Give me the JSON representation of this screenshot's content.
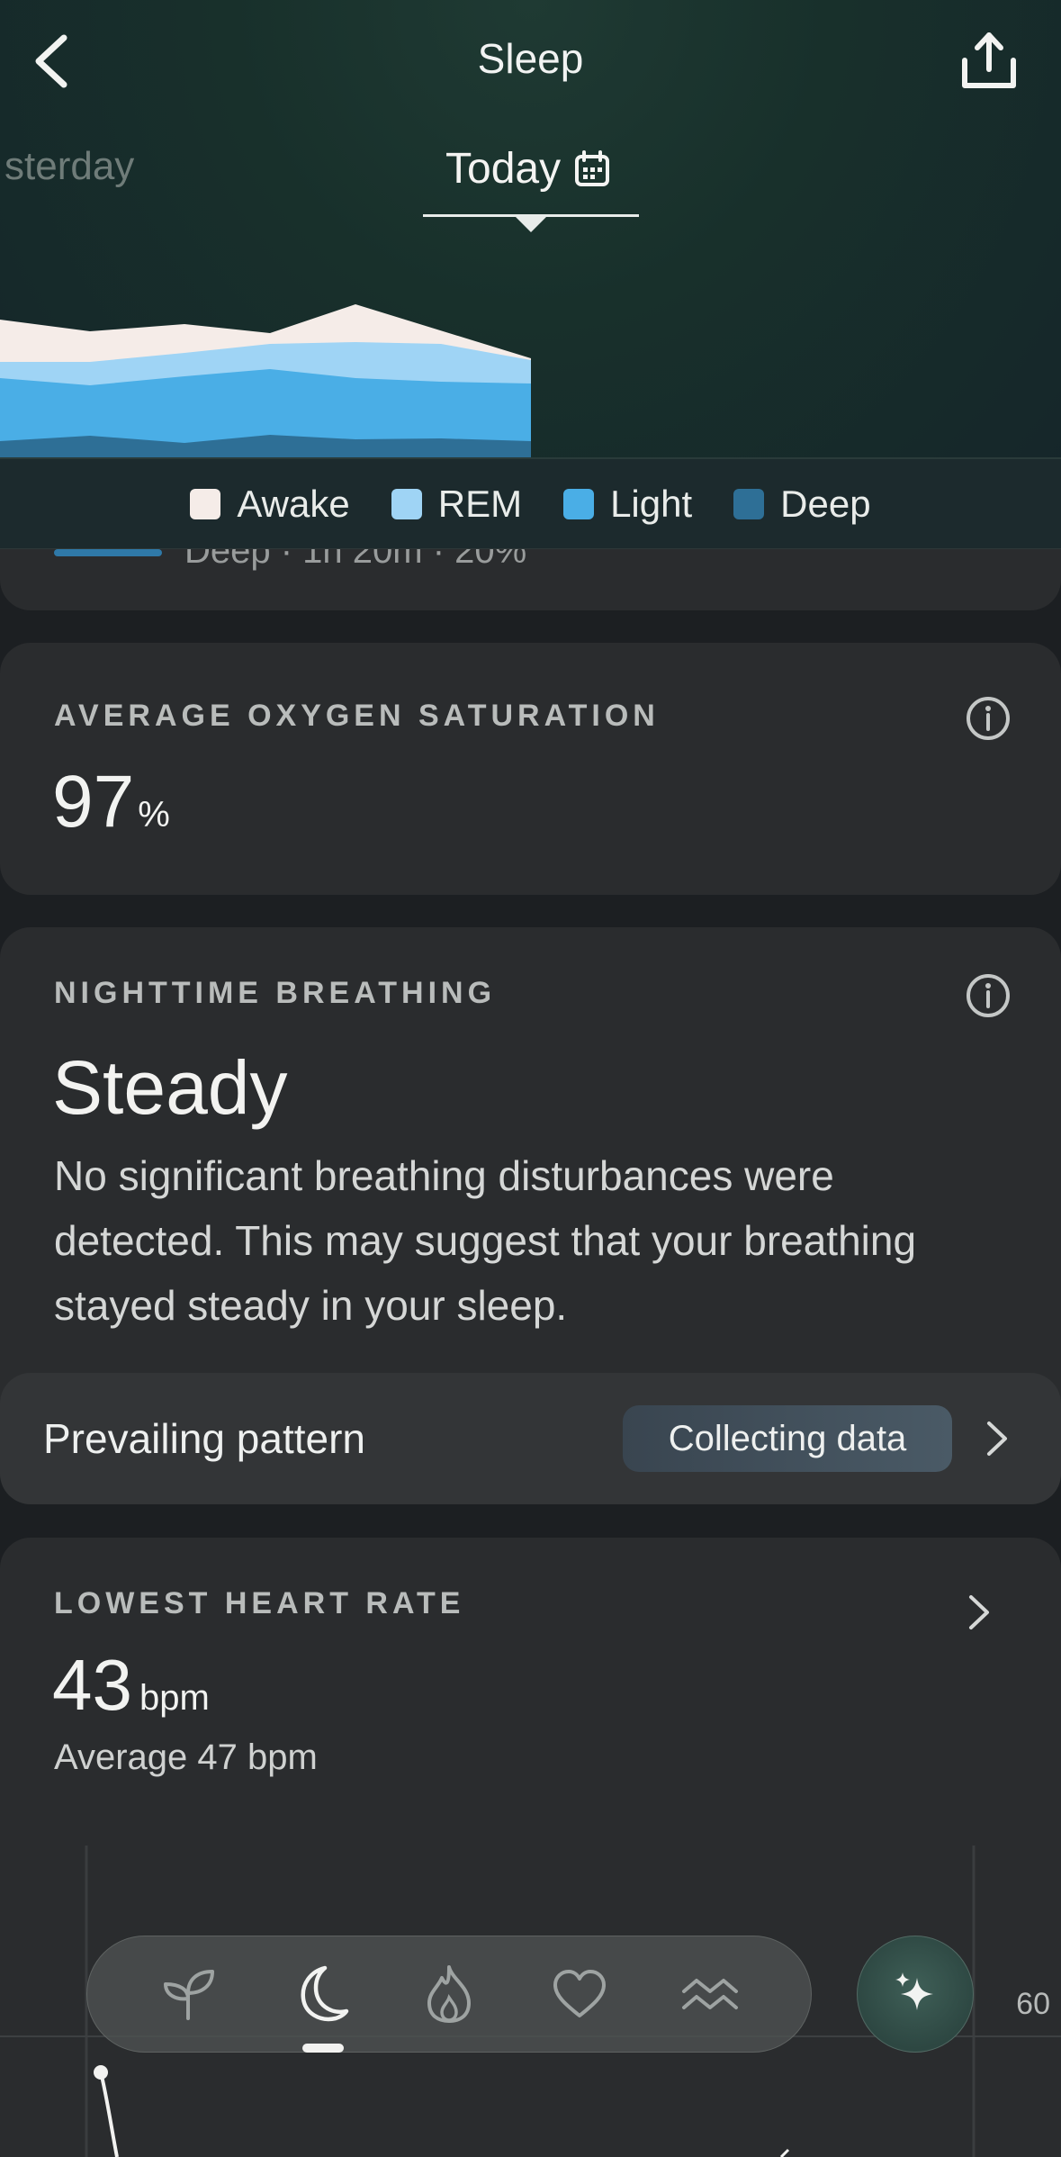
{
  "header": {
    "title": "Sleep",
    "back_icon": "chevron-left-icon",
    "share_icon": "share-icon"
  },
  "day_selector": {
    "previous_label": "sterday",
    "current_label": "Today",
    "calendar_icon": "calendar-icon"
  },
  "legend": [
    {
      "label": "Awake",
      "color": "#f5ece8"
    },
    {
      "label": "REM",
      "color": "#9fd4f5"
    },
    {
      "label": "Light",
      "color": "#4aaee6"
    },
    {
      "label": "Deep",
      "color": "#2e6f96"
    }
  ],
  "partial_card": {
    "text": "Deep · 1h 20m · 20%"
  },
  "oxygen": {
    "label": "AVERAGE OXYGEN SATURATION",
    "value": "97",
    "unit": "%"
  },
  "breathing": {
    "label": "NIGHTTIME BREATHING",
    "status": "Steady",
    "description": "No significant breathing disturbances were detected. This may suggest that your breathing stayed steady in your sleep.",
    "pattern_label": "Prevailing pattern",
    "pattern_value": "Collecting data"
  },
  "heart": {
    "label": "LOWEST HEART RATE",
    "value": "43",
    "unit": "bpm",
    "average": "Average 47 bpm",
    "axis_tick": "60"
  },
  "nav": {
    "items": [
      "sprout-icon",
      "moon-icon",
      "flame-icon",
      "heart-icon",
      "waves-icon"
    ],
    "active": "moon-icon",
    "assistant_icon": "sparkles-icon"
  }
}
